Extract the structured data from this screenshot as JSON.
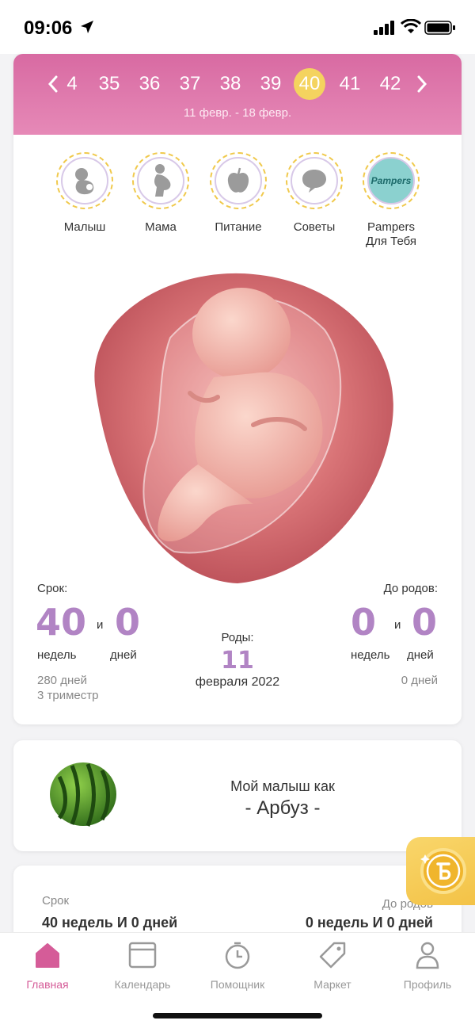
{
  "status": {
    "time": "09:06"
  },
  "weeks": {
    "items": [
      "4",
      "35",
      "36",
      "37",
      "38",
      "39",
      "40",
      "41",
      "42"
    ],
    "selected": "40",
    "range": "11 февр. - 18 февр."
  },
  "categories": [
    {
      "label": "Малыш",
      "icon": "baby-icon"
    },
    {
      "label": "Мама",
      "icon": "mother-icon"
    },
    {
      "label": "Питание",
      "icon": "apple-icon"
    },
    {
      "label": "Советы",
      "icon": "chat-bubble-icon"
    },
    {
      "label": "Pampers\nДля Тебя",
      "icon": "pampers-logo",
      "logo_text": "Pampers"
    }
  ],
  "term": {
    "label": "Срок:",
    "weeks": "40",
    "and": "и",
    "days": "0",
    "weeks_unit": "недель",
    "days_unit": "дней",
    "total_days": "280 дней",
    "trimester": "3 триместр"
  },
  "due": {
    "label": "Роды:",
    "day": "11",
    "month_year": "февраля 2022"
  },
  "remaining": {
    "label": "До родов:",
    "weeks": "0",
    "and": "и",
    "days": "0",
    "weeks_unit": "недель",
    "days_unit": "дней",
    "total_days": "0 дней"
  },
  "fruit": {
    "title": "Мой малыш как",
    "name": "- Арбуз -"
  },
  "summary": {
    "left_label": "Срок",
    "left_value": "40 недель И 0 дней",
    "right_label": "До родов",
    "right_value": "0 недель И 0 дней"
  },
  "tabs": [
    {
      "label": "Главная",
      "icon": "home-icon",
      "active": true
    },
    {
      "label": "Календарь",
      "icon": "calendar-icon",
      "active": false
    },
    {
      "label": "Помощник",
      "icon": "timer-icon",
      "active": false
    },
    {
      "label": "Маркет",
      "icon": "tag-icon",
      "active": false
    },
    {
      "label": "Профиль",
      "icon": "profile-icon",
      "active": false
    }
  ],
  "colors": {
    "header_pink": "#d86aa2",
    "selected_week": "#f4d35f",
    "accent_purple": "#b184c4",
    "active_tab": "#d55c98"
  }
}
